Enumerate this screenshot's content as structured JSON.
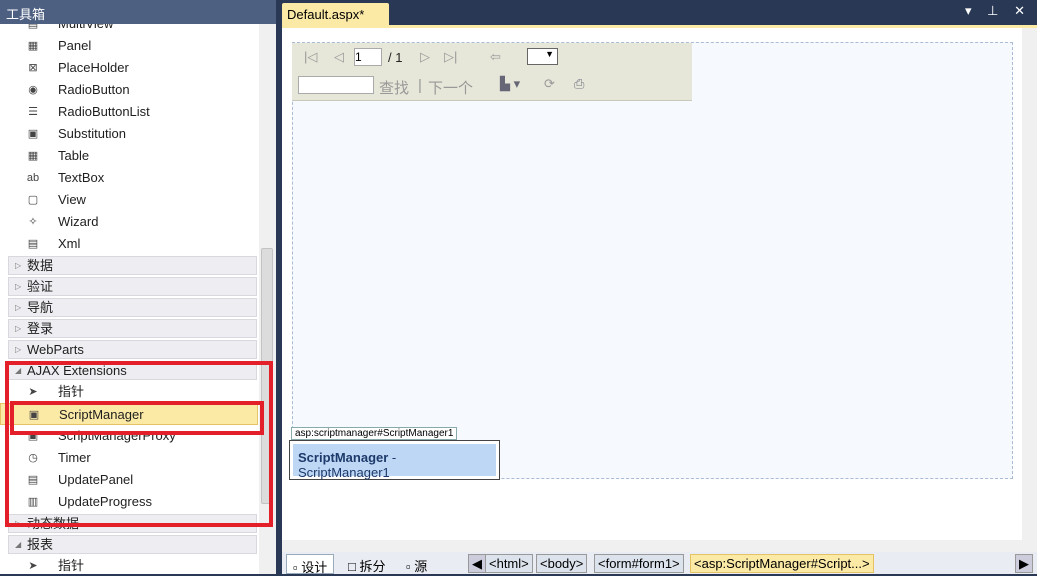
{
  "toolbox": {
    "title": "工具箱",
    "controls": "▾ ⊥ ✕",
    "items_top": [
      {
        "label": "MultiView",
        "icon": "multiview-icon",
        "g": "▤"
      },
      {
        "label": "Panel",
        "icon": "panel-icon",
        "g": "▦"
      },
      {
        "label": "PlaceHolder",
        "icon": "placeholder-icon",
        "g": "⊠"
      },
      {
        "label": "RadioButton",
        "icon": "radio-icon",
        "g": "◉"
      },
      {
        "label": "RadioButtonList",
        "icon": "radio-list-icon",
        "g": "☰"
      },
      {
        "label": "Substitution",
        "icon": "substitution-icon",
        "g": "▣"
      },
      {
        "label": "Table",
        "icon": "table-icon",
        "g": "▦"
      },
      {
        "label": "TextBox",
        "icon": "textbox-icon",
        "g": "ab"
      },
      {
        "label": "View",
        "icon": "view-icon",
        "g": "▢"
      },
      {
        "label": "Wizard",
        "icon": "wizard-icon",
        "g": "✧"
      },
      {
        "label": "Xml",
        "icon": "xml-icon",
        "g": "▤"
      }
    ],
    "categories": [
      "数据",
      "验证",
      "导航",
      "登录",
      "WebParts"
    ],
    "ajax": {
      "label": "AJAX Extensions",
      "items": [
        {
          "label": "指针",
          "icon": "pointer-icon",
          "g": "➤"
        },
        {
          "label": "ScriptManager",
          "icon": "scriptmanager-icon",
          "g": "▣"
        },
        {
          "label": "ScriptManagerProxy",
          "icon": "scriptmanagerproxy-icon",
          "g": "▣"
        },
        {
          "label": "Timer",
          "icon": "timer-icon",
          "g": "◷"
        },
        {
          "label": "UpdatePanel",
          "icon": "updatepanel-icon",
          "g": "▤"
        },
        {
          "label": "UpdateProgress",
          "icon": "updateprogress-icon",
          "g": "▥"
        }
      ]
    },
    "dynamic": "动态数据",
    "report": "报表",
    "report_pointer": "指针"
  },
  "tab": {
    "label": "Default.aspx*",
    "close": "✕"
  },
  "report_viewer": {
    "page": "1",
    "total": "/ 1",
    "find": "查找",
    "next": "下一个"
  },
  "script_manager": {
    "tag": "asp:scriptmanager#ScriptManager1",
    "name": "ScriptManager",
    "id": " - ScriptManager1"
  },
  "bottom": {
    "design": "设计",
    "split": "拆分",
    "source": "源",
    "crumbs": [
      "<html>",
      "<body>",
      "<form#form1>",
      "<asp:ScriptManager#Script...>"
    ]
  },
  "colors": {
    "highlight": "#fbe9a6",
    "annotation": "#e3202a",
    "chrome": "#293955"
  }
}
